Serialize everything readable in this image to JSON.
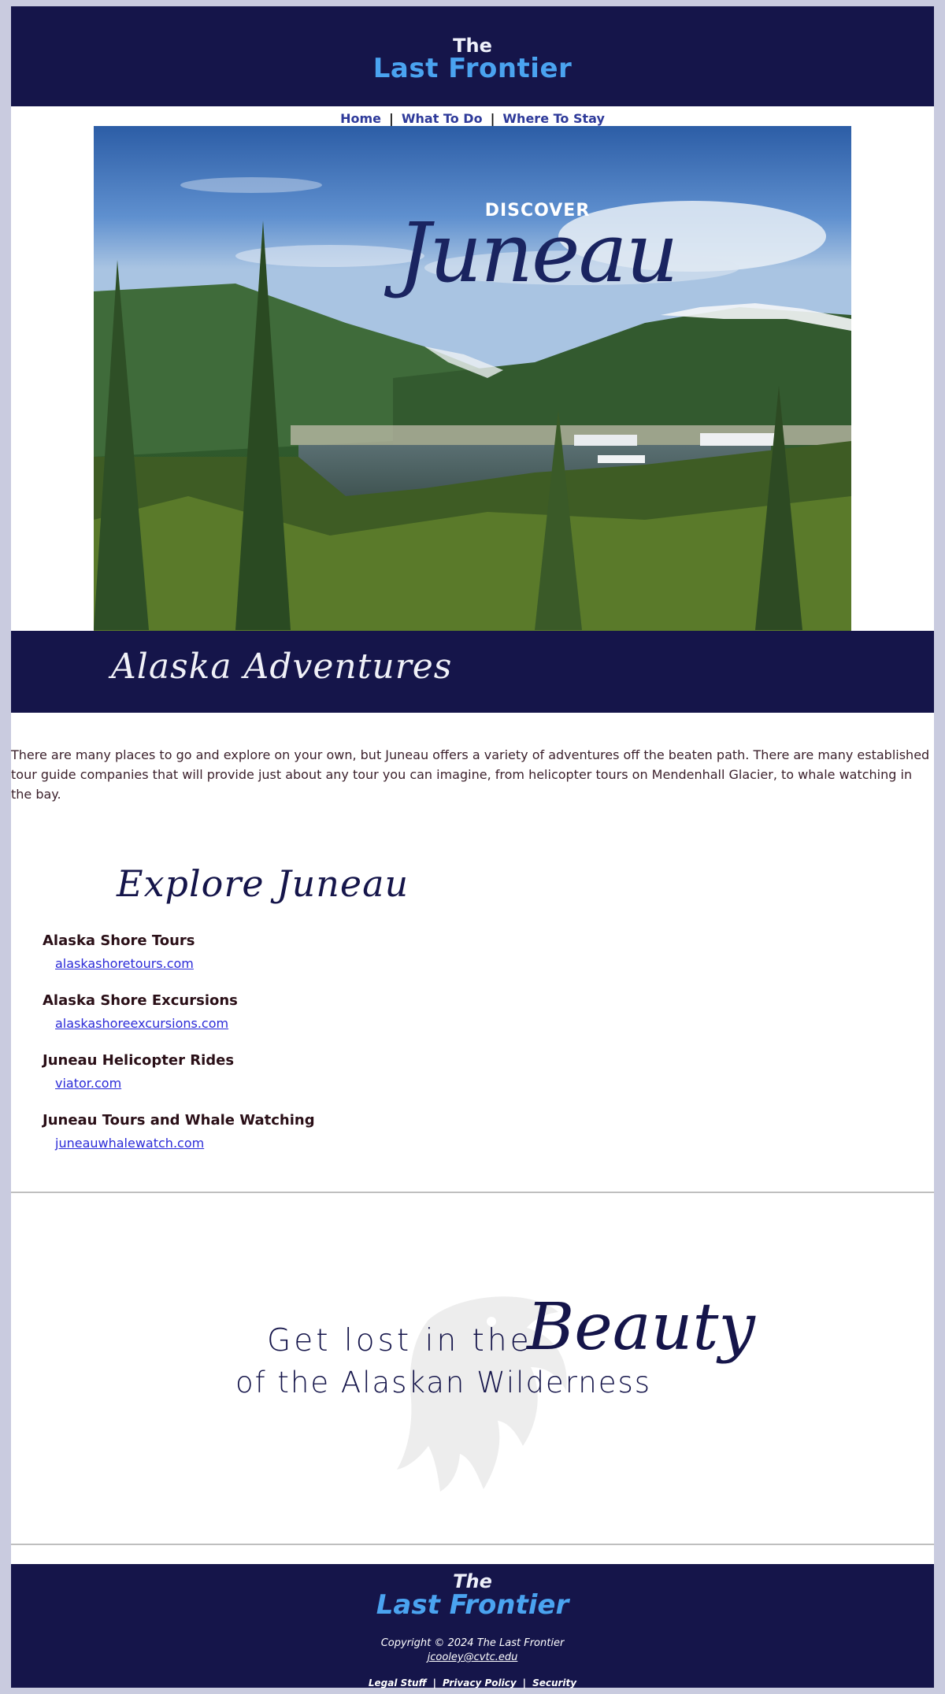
{
  "header": {
    "the": "The",
    "brand": "Last Frontier"
  },
  "nav": {
    "items": [
      {
        "label": "Home"
      },
      {
        "label": "What To Do"
      },
      {
        "label": "Where To Stay"
      }
    ],
    "separator": "|"
  },
  "hero": {
    "kicker": "DISCOVER",
    "title": "Juneau"
  },
  "adventures": {
    "heading": "Alaska Adventures",
    "intro": "There are many places to go and explore on your own, but Juneau offers a variety of adventures off the beaten path. There are many established tour guide companies that will provide just about any tour you can imagine, from helicopter tours on Mendenhall Glacier, to whale watching in the bay."
  },
  "explore": {
    "heading": "Explore Juneau",
    "tours": [
      {
        "name": "Alaska Shore Tours",
        "link": "alaskashoretours.com"
      },
      {
        "name": "Alaska Shore Excursions",
        "link": "alaskashoreexcursions.com"
      },
      {
        "name": "Juneau Helicopter Rides",
        "link": "viator.com"
      },
      {
        "name": "Juneau Tours and Whale Watching",
        "link": "juneauwhalewatch.com"
      }
    ]
  },
  "beauty": {
    "line1": "Get lost in the",
    "script": "Beauty",
    "line2": "of the Alaskan Wilderness"
  },
  "footer": {
    "the": "The",
    "brand": "Last Frontier",
    "copyright": "Copyright © 2024 The Last Frontier",
    "email": "jcooley@cvtc.edu",
    "links": [
      {
        "label": "Legal Stuff"
      },
      {
        "label": "Privacy Policy"
      },
      {
        "label": "Security"
      }
    ],
    "separator": "|"
  },
  "colors": {
    "navy": "#15154a",
    "brand_blue": "#4aa3f0",
    "link_blue": "#2b2bd8",
    "page_bg": "#c9cbdf"
  }
}
